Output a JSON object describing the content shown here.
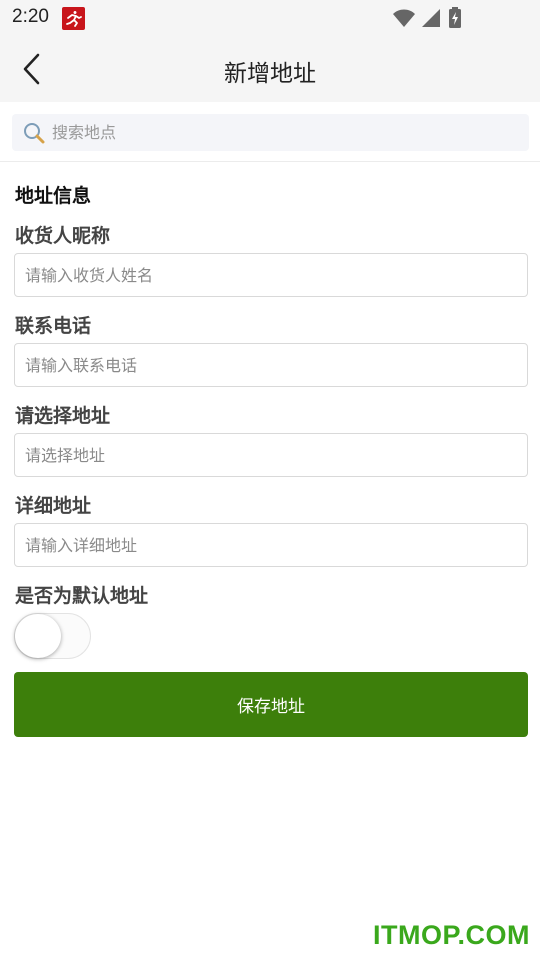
{
  "status_bar": {
    "time": "2:20",
    "icons": [
      "app-notification-icon",
      "wifi-icon",
      "signal-icon",
      "battery-icon"
    ]
  },
  "header": {
    "back_icon": "chevron-left-icon",
    "title": "新增地址"
  },
  "search": {
    "icon": "search-icon",
    "placeholder": "搜索地点"
  },
  "form": {
    "section_title": "地址信息",
    "fields": [
      {
        "label": "收货人昵称",
        "placeholder": "请输入收货人姓名",
        "value": ""
      },
      {
        "label": "联系电话",
        "placeholder": "请输入联系电话",
        "value": ""
      },
      {
        "label": "请选择地址",
        "placeholder": "请选择地址",
        "value": ""
      },
      {
        "label": "详细地址",
        "placeholder": "请输入详细地址",
        "value": ""
      }
    ],
    "default_toggle": {
      "label": "是否为默认地址",
      "on": false
    },
    "save_label": "保存地址"
  },
  "watermark": "ITMOP.COM",
  "colors": {
    "accent": "#3d7f0b",
    "header_bg": "#f5f5f5",
    "search_bg": "#f4f5f9",
    "watermark": "#3aa81c",
    "app_icon": "#c8151b"
  }
}
